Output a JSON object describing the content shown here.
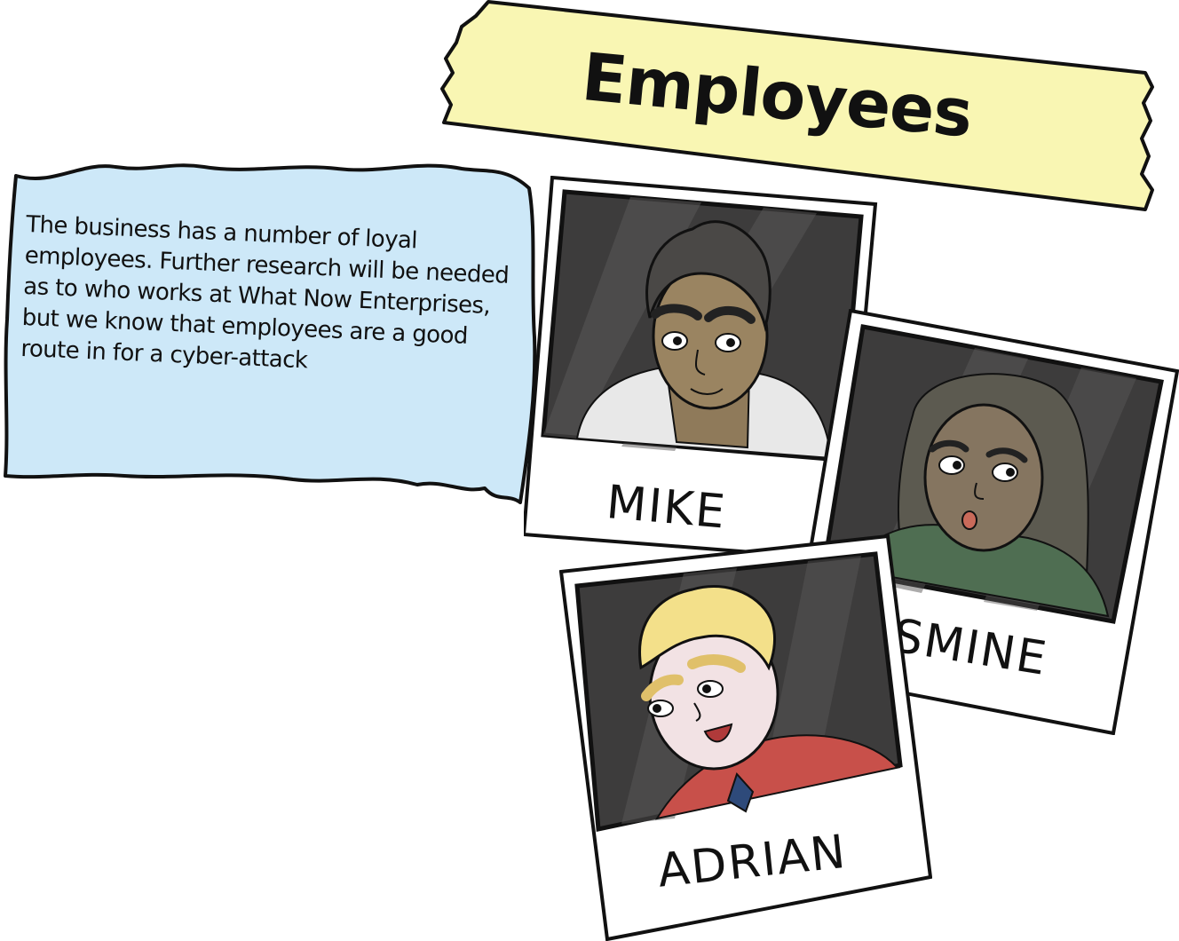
{
  "title": "Employees",
  "info": {
    "text": "The business has a number of loyal employees.  Further research will be needed as to who works at What Now Enterprises, but we know that employees are a good route in for a cyber-attack"
  },
  "employees": [
    {
      "name": "MIKE"
    },
    {
      "name": "JASMINE"
    },
    {
      "name": "ADRIAN"
    }
  ],
  "colors": {
    "banner": "#f9f6b3",
    "info_box": "#cde8f8",
    "photo_bg": "#3d3c3c",
    "outline": "#111111"
  }
}
